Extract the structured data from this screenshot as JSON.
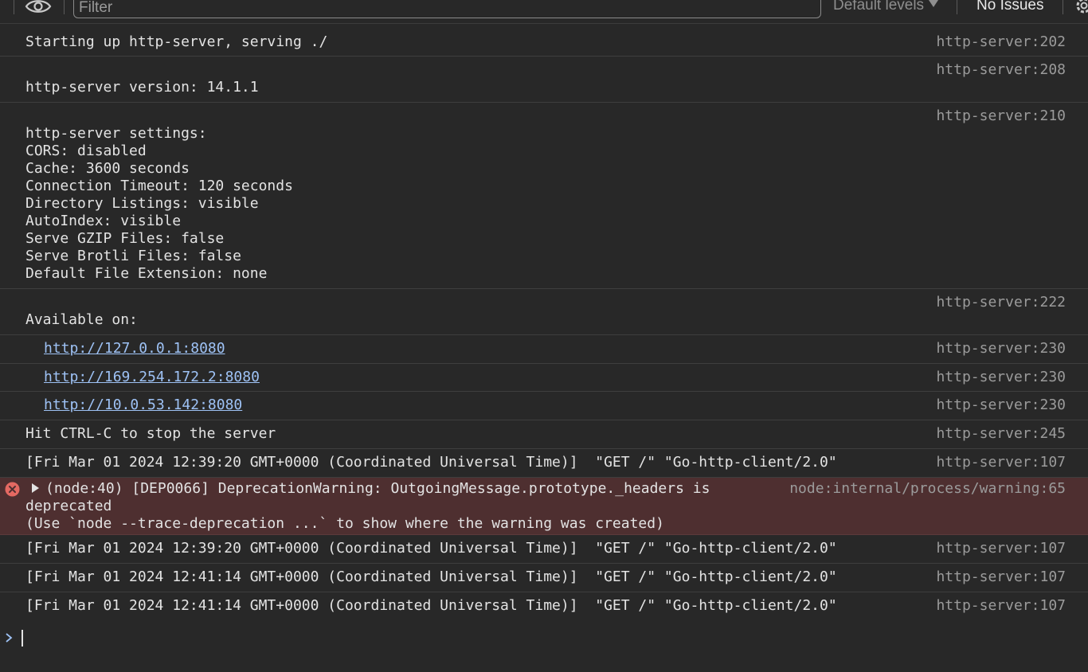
{
  "toolbar": {
    "filter_placeholder": "Filter",
    "levels_label": "Default levels",
    "issues_label": "No Issues"
  },
  "console": {
    "messages": [
      {
        "text": "Starting up http-server, serving ./",
        "source": "http-server:202"
      },
      {
        "text": "http-server version: 14.1.1",
        "source": "http-server:208"
      },
      {
        "lines": [
          "http-server settings:",
          "CORS: disabled",
          "Cache: 3600 seconds",
          "Connection Timeout: 120 seconds",
          "Directory Listings: visible",
          "AutoIndex: visible",
          "Serve GZIP Files: false",
          "Serve Brotli Files: false",
          "Default File Extension: none"
        ],
        "source": "http-server:210"
      },
      {
        "text": "Available on:",
        "source": "http-server:222"
      },
      {
        "link": "http://127.0.0.1:8080",
        "source": "http-server:230"
      },
      {
        "link": "http://169.254.172.2:8080",
        "source": "http-server:230"
      },
      {
        "link": "http://10.0.53.142:8080",
        "source": "http-server:230"
      },
      {
        "text": "Hit CTRL-C to stop the server",
        "source": "http-server:245"
      },
      {
        "text": "[Fri Mar 01 2024 12:39:20 GMT+0000 (Coordinated Universal Time)]  \"GET /\" \"Go-http-client/2.0\"",
        "source": "http-server:107"
      },
      {
        "error": true,
        "lines": [
          "(node:40) [DEP0066] DeprecationWarning: OutgoingMessage.prototype._headers is",
          "deprecated",
          "(Use `node --trace-deprecation ...` to show where the warning was created)"
        ],
        "source": "node:internal/process/warning:65"
      },
      {
        "text": "[Fri Mar 01 2024 12:39:20 GMT+0000 (Coordinated Universal Time)]  \"GET /\" \"Go-http-client/2.0\"",
        "source": "http-server:107"
      },
      {
        "text": "[Fri Mar 01 2024 12:41:14 GMT+0000 (Coordinated Universal Time)]  \"GET /\" \"Go-http-client/2.0\"",
        "source": "http-server:107"
      },
      {
        "text": "[Fri Mar 01 2024 12:41:14 GMT+0000 (Coordinated Universal Time)]  \"GET /\" \"Go-http-client/2.0\"",
        "source": "http-server:107"
      }
    ]
  },
  "colors": {
    "background": "#282828",
    "link": "#9ec2f5",
    "error_row": "#4e2f30",
    "error_icon": "#e46962",
    "prompt": "#9ec2f5"
  }
}
